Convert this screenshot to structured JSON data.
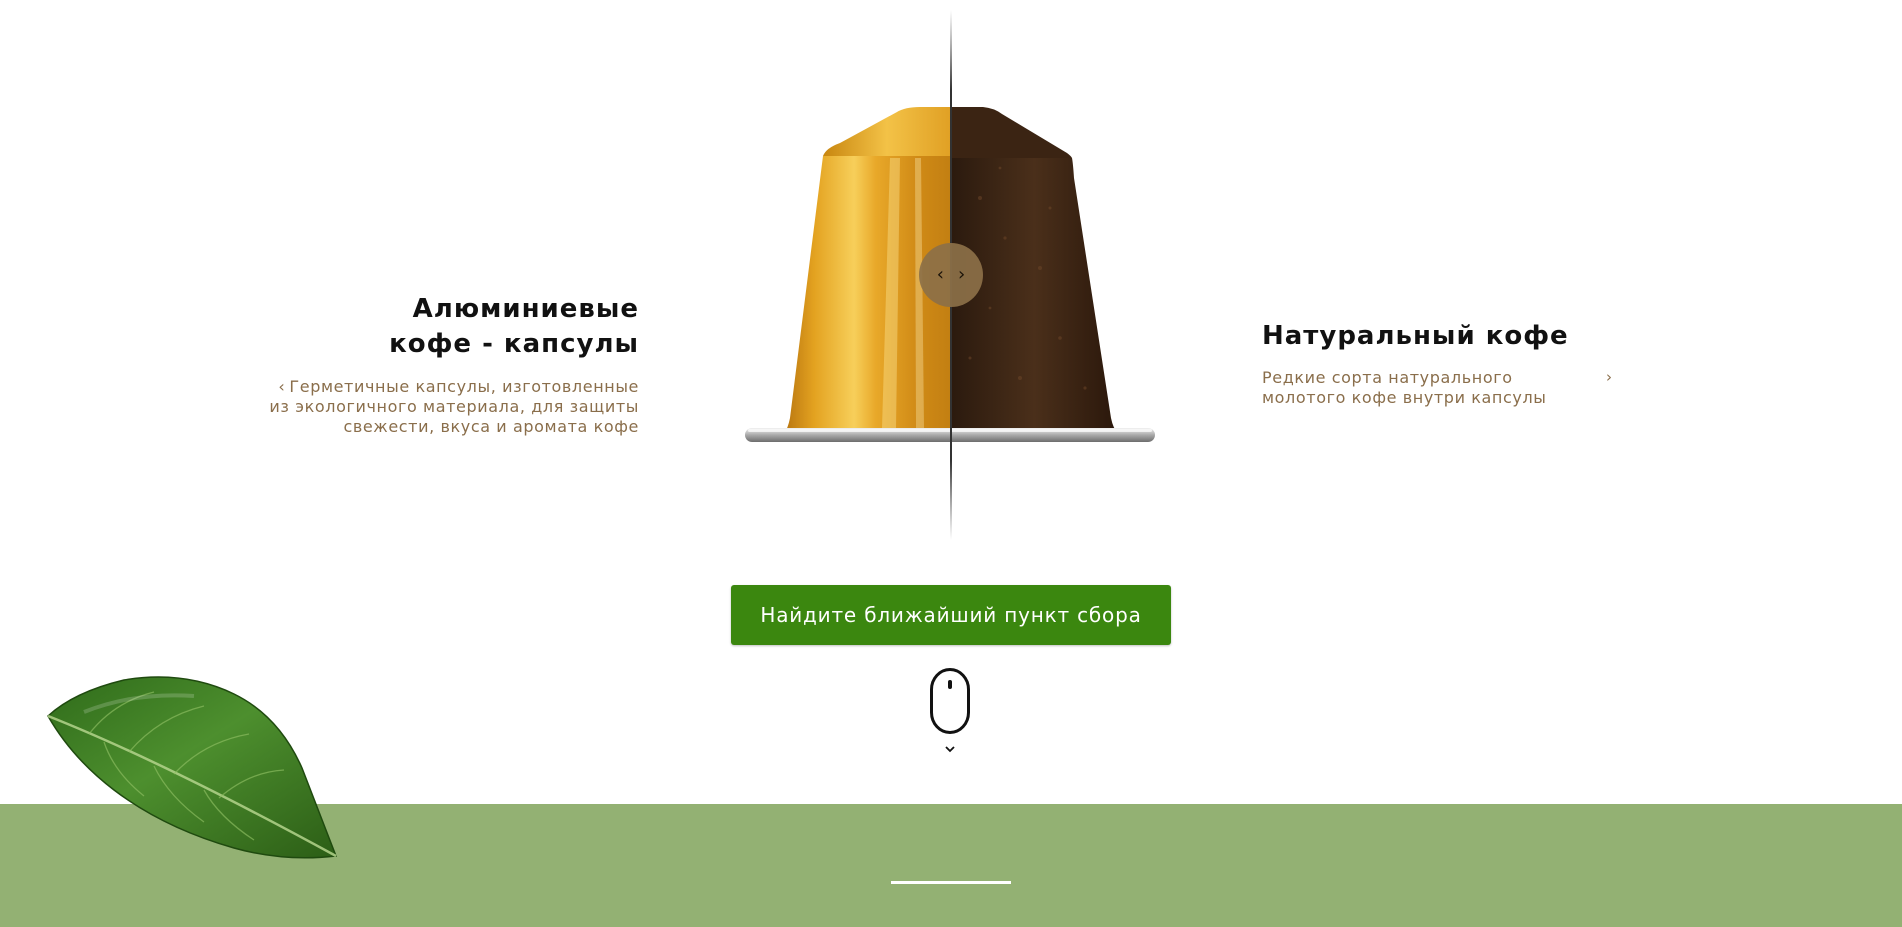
{
  "left_feature": {
    "title_line1": "Алюминиевые",
    "title_line2": "кофе - капсулы",
    "prev_icon": "chevron-left-icon",
    "desc_line1": "Герметичные капсулы, изготовленные",
    "desc_line2": "из экологичного материала, для защиты",
    "desc_line3": "свежести, вкуса и аромата кофе"
  },
  "right_feature": {
    "title": "Натуральный кофе",
    "desc_line1": "Редкие сорта натурального",
    "desc_line2": "молотого кофе внутри капсулы",
    "next_icon": "chevron-right-icon"
  },
  "slider": {
    "left_icon": "chevron-left-icon",
    "right_icon": "chevron-right-icon",
    "position": 0.5
  },
  "cta": {
    "label": "Найдите ближайший пункт сбора"
  },
  "scroll_hint": {
    "icon": "mouse-icon",
    "chevron": "chevron-down-icon"
  },
  "decor": {
    "leaf": "coffee-leaf-image"
  },
  "colors": {
    "accent_green": "#3b870f",
    "band_green": "#93b173",
    "text_brown": "#8a6e4b",
    "capsule_gold": "#d89a1c",
    "coffee_dark": "#3a2414"
  }
}
